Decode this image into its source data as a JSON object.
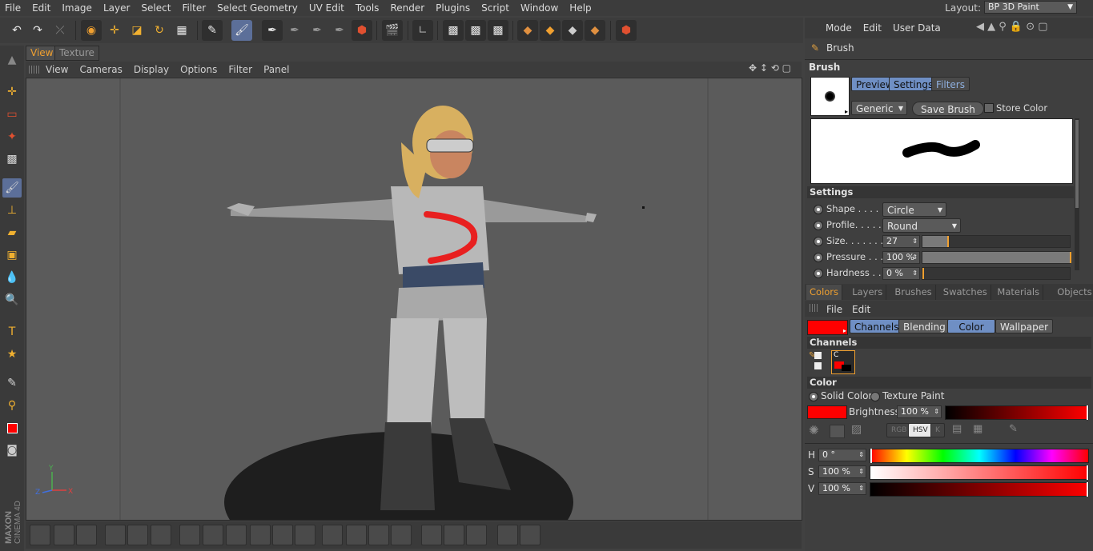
{
  "menubar": {
    "items": [
      "File",
      "Edit",
      "Image",
      "Layer",
      "Select",
      "Filter",
      "Select Geometry",
      "UV Edit",
      "Tools",
      "Render",
      "Plugins",
      "Script",
      "Window",
      "Help"
    ],
    "layout_label": "Layout:",
    "layout_value": "BP 3D Paint"
  },
  "toolbar": {
    "icons": [
      "undo-icon",
      "redo-icon",
      "reset-icon",
      "live-selection-icon",
      "move-icon",
      "scale-icon",
      "rotate-icon",
      "checker-icon",
      "paint-setup-icon",
      "3d-paint-mode-icon",
      "brush-projection-icon",
      "brush-uv-icon",
      "brush-uv-off-icon",
      "brush-off-icon",
      "hex-icon",
      "render-icon",
      "view-icon",
      "checkered-a-icon",
      "checkered-b-icon",
      "checkered-c-icon",
      "cube-a-icon",
      "cube-b-icon",
      "cube-c-icon",
      "cube-d-icon",
      "hex-render-icon"
    ]
  },
  "viewport": {
    "tabs": [
      "View",
      "Texture"
    ],
    "menu": [
      "View",
      "Cameras",
      "Display",
      "Options",
      "Filter",
      "Panel"
    ],
    "axis_y": "Y",
    "axis_z": "Z",
    "axis_x": "X"
  },
  "branding": {
    "line1": "MAXON",
    "line2": "CINEMA 4D"
  },
  "attr": {
    "menu": [
      "Mode",
      "Edit",
      "User Data"
    ],
    "tool_name": "Brush",
    "section_title": "Brush",
    "tabs": [
      "Preview",
      "Settings",
      "Filters"
    ],
    "preset": "Generic",
    "save_brush": "Save Brush",
    "store_color": "Store Color",
    "settings_title": "Settings",
    "settings": [
      {
        "label": "Shape . . . . .",
        "value": "Circle",
        "kind": "select"
      },
      {
        "label": "Profile. . . . .",
        "value": "Round",
        "kind": "select"
      },
      {
        "label": "Size. . . . . . .",
        "value": "27",
        "kind": "slider",
        "level": 0.17
      },
      {
        "label": "Pressure . . .",
        "value": "100 %",
        "kind": "slider",
        "level": 1.0
      },
      {
        "label": "Hardness . .",
        "value": "0 %",
        "kind": "slider",
        "level": 0.0
      }
    ]
  },
  "colorpanel": {
    "tabs": [
      "Colors",
      "Layers",
      "Brushes",
      "Swatches",
      "Materials",
      "Objects"
    ],
    "menu": [
      "File",
      "Edit"
    ],
    "subtabs": [
      "Channels",
      "Blending",
      "Color",
      "Wallpaper"
    ],
    "channels_title": "Channels",
    "channel_label": "C",
    "color_title": "Color",
    "mode_solid": "Solid Color",
    "mode_texture": "Texture Paint",
    "brightness_label": "Brightness",
    "brightness_value": "100 %",
    "mode_buttons": [
      "RGB",
      "HSV",
      "K"
    ],
    "h_label": "H",
    "h_value": "0 °",
    "s_label": "S",
    "s_value": "100 %",
    "v_label": "V",
    "v_value": "100 %"
  },
  "colors": {
    "accent": "#6f8fc4",
    "paint": "#ff0000",
    "highlight_orange": "#f0a030"
  }
}
